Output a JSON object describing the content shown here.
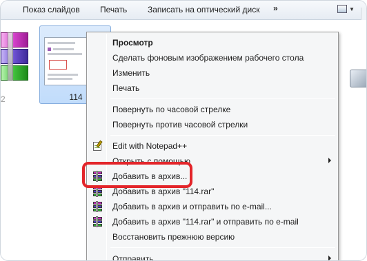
{
  "toolbar": {
    "items": [
      "Показ слайдов",
      "Печать",
      "Записать на оптический диск"
    ],
    "more": "»"
  },
  "files": {
    "left_caption": "2",
    "selected_label": "114"
  },
  "menu": {
    "items": [
      {
        "label": "Просмотр",
        "bold": true
      },
      {
        "label": "Сделать фоновым изображением рабочего стола"
      },
      {
        "label": "Изменить"
      },
      {
        "label": "Печать"
      },
      {
        "label": "Повернуть по часовой стрелке"
      },
      {
        "label": "Повернуть против часовой стрелки"
      },
      {
        "label": "Edit with Notepad++",
        "icon": "notepad-plus-plus-icon"
      },
      {
        "label": "Открыть с помощью",
        "submenu": true
      },
      {
        "label": "Добавить в архив...",
        "icon": "winrar-icon"
      },
      {
        "label": "Добавить в архив \"114.rar\"",
        "icon": "winrar-icon"
      },
      {
        "label": "Добавить в архив и отправить по e-mail...",
        "icon": "winrar-icon"
      },
      {
        "label": "Добавить в архив \"114.rar\" и отправить по e-mail",
        "icon": "winrar-icon"
      },
      {
        "label": "Восстановить прежнюю версию"
      },
      {
        "label": "Отправить",
        "submenu": true
      }
    ]
  },
  "colors": {
    "highlight": "#e3252a",
    "selection": "#c1dcfb"
  }
}
